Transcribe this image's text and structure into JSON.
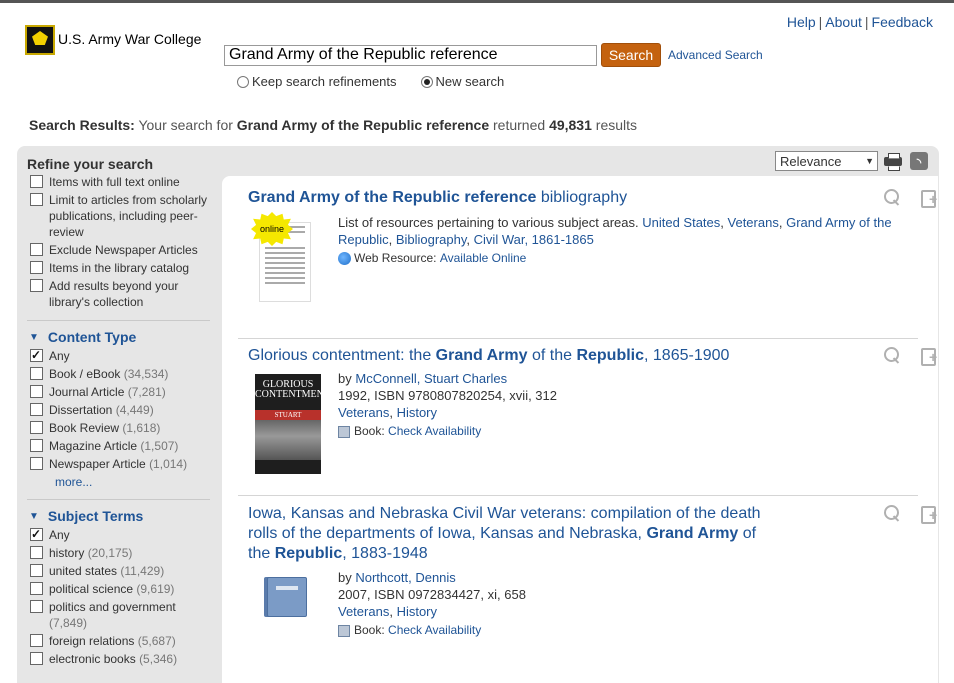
{
  "header": {
    "logo_text": "U.S. Army War College",
    "links": [
      "Help",
      "About",
      "Feedback"
    ]
  },
  "search": {
    "query": "Grand Army of the Republic reference",
    "button": "Search",
    "advanced": "Advanced Search",
    "option_keep": "Keep search refinements",
    "option_new": "New search"
  },
  "summary": {
    "label": "Search Results:",
    "pre": "Your search for",
    "query": "Grand Army of the Republic reference",
    "mid": "returned",
    "count": "49,831",
    "post": "results"
  },
  "sort": {
    "selected": "Relevance"
  },
  "sidebar": {
    "title": "Refine your search",
    "refinements": [
      {
        "label": "Items with full text online",
        "checked": false
      },
      {
        "label": "Limit to articles from scholarly publications, including peer-review",
        "checked": false
      },
      {
        "label": "Exclude Newspaper Articles",
        "checked": false
      },
      {
        "label": "Items in the library catalog",
        "checked": false
      },
      {
        "label": "Add results beyond your library's collection",
        "checked": false
      }
    ],
    "content_type": {
      "title": "Content Type",
      "items": [
        {
          "label": "Any",
          "count": "",
          "checked": true
        },
        {
          "label": "Book / eBook",
          "count": "(34,534)",
          "checked": false
        },
        {
          "label": "Journal Article",
          "count": "(7,281)",
          "checked": false
        },
        {
          "label": "Dissertation",
          "count": "(4,449)",
          "checked": false
        },
        {
          "label": "Book Review",
          "count": "(1,618)",
          "checked": false
        },
        {
          "label": "Magazine Article",
          "count": "(1,507)",
          "checked": false
        },
        {
          "label": "Newspaper Article",
          "count": "(1,014)",
          "checked": false
        }
      ],
      "more": "more..."
    },
    "subject_terms": {
      "title": "Subject Terms",
      "items": [
        {
          "label": "Any",
          "count": "",
          "checked": true
        },
        {
          "label": "history",
          "count": "(20,175)",
          "checked": false
        },
        {
          "label": "united states",
          "count": "(11,429)",
          "checked": false
        },
        {
          "label": "political science",
          "count": "(9,619)",
          "checked": false
        },
        {
          "label": "politics and government",
          "count": "(7,849)",
          "checked": false
        },
        {
          "label": "foreign relations",
          "count": "(5,687)",
          "checked": false
        },
        {
          "label": "electronic books",
          "count": "(5,346)",
          "checked": false
        }
      ]
    }
  },
  "results": [
    {
      "title_bold": "Grand Army of the Republic reference",
      "title_rest": " bibliography",
      "description": "List of resources pertaining to various subject areas.",
      "subjects": [
        "United States",
        "Veterans",
        "Grand Army of the Republic",
        "Bibliography",
        "Civil War, 1861-1865"
      ],
      "format_label": "Web Resource:",
      "format_link": "Available Online",
      "badge": "online"
    },
    {
      "title_parts": [
        "Glorious contentment: the ",
        "Grand Army",
        " of the ",
        "Republic",
        ", 1865-1900"
      ],
      "by": "by",
      "author": "McConnell, Stuart Charles",
      "pub": "1992, ISBN 9780807820254, xvii, 312",
      "subjects": [
        "Veterans",
        "History"
      ],
      "format_label": "Book:",
      "format_link": "Check Availability",
      "cover_title": "GLORIOUS CONTENTMENT",
      "cover_author": "STUART McCONNELL"
    },
    {
      "title_parts": [
        "Iowa, Kansas and Nebraska Civil War veterans: compilation of the death rolls of the departments of Iowa, Kansas and Nebraska, ",
        "Grand Army",
        " of the ",
        "Republic",
        ", 1883-1948"
      ],
      "by": "by",
      "author": "Northcott, Dennis",
      "pub": "2007, ISBN 0972834427, xi, 658",
      "subjects": [
        "Veterans",
        "History"
      ],
      "format_label": "Book:",
      "format_link": "Check Availability"
    }
  ]
}
